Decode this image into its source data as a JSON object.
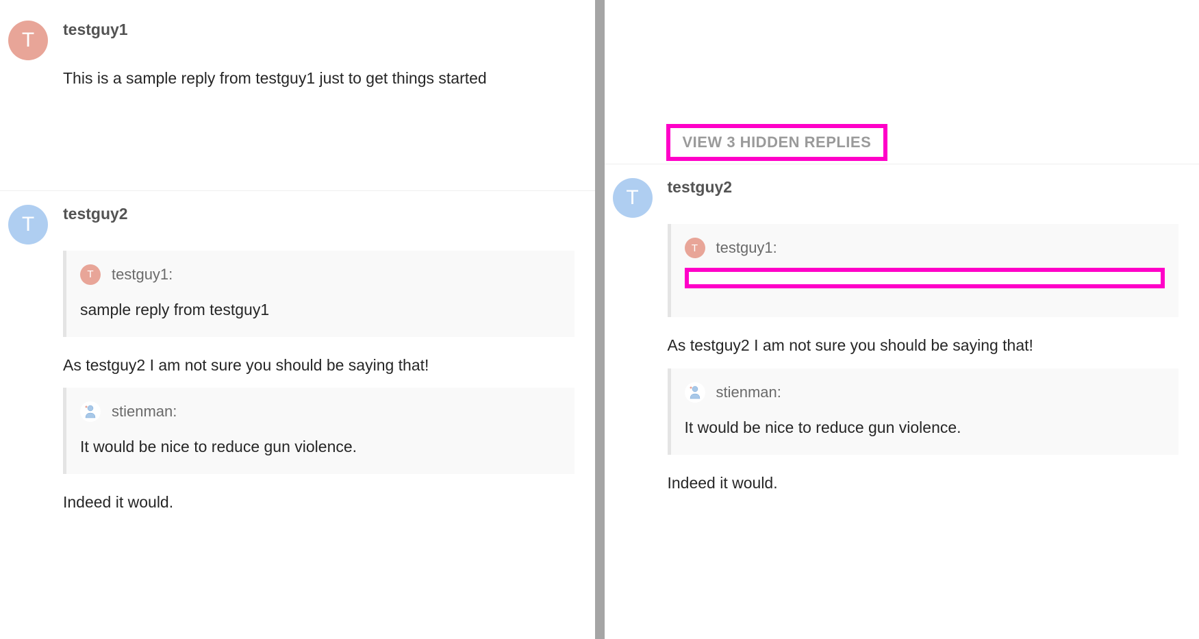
{
  "left": {
    "post1": {
      "avatar_letter": "T",
      "username": "testguy1",
      "body": "This is a sample reply from testguy1 just to get things started"
    },
    "post2": {
      "avatar_letter": "T",
      "username": "testguy2",
      "quote1": {
        "avatar_letter": "T",
        "username": "testguy1:",
        "text": "sample reply from testguy1"
      },
      "reply1": "As testguy2 I am not sure you should be saying that!",
      "quote2": {
        "username": "stienman:",
        "text": "It would be nice to reduce gun violence."
      },
      "reply2": "Indeed it would."
    }
  },
  "right": {
    "hidden_replies_label": "VIEW 3 HIDDEN REPLIES",
    "post": {
      "avatar_letter": "T",
      "username": "testguy2",
      "quote1": {
        "avatar_letter": "T",
        "username": "testguy1:"
      },
      "reply1": "As testguy2 I am not sure you should be saying that!",
      "quote2": {
        "username": "stienman:",
        "text": "It would be nice to reduce gun violence."
      },
      "reply2": "Indeed it would."
    }
  }
}
